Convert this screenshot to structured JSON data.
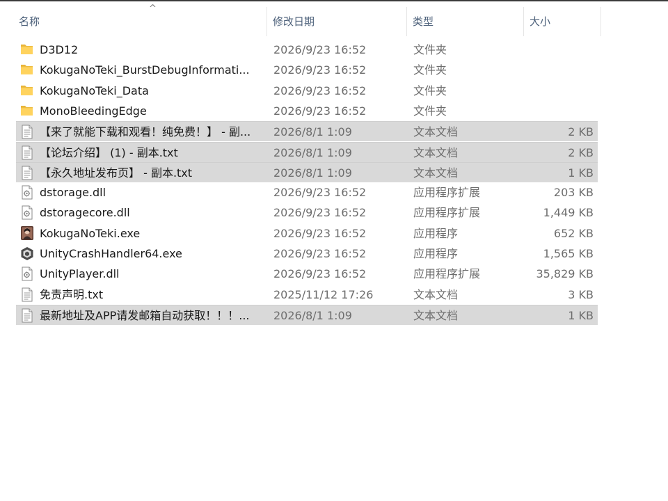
{
  "columns": {
    "name": "名称",
    "date": "修改日期",
    "type": "类型",
    "size": "大小"
  },
  "sort_indicator": "^",
  "files": [
    {
      "name": "D3D12",
      "date": "2026/9/23 16:52",
      "type": "文件夹",
      "size": "",
      "icon": "folder-icon",
      "selected": false
    },
    {
      "name": "KokugaNoTeki_BurstDebugInformati...",
      "date": "2026/9/23 16:52",
      "type": "文件夹",
      "size": "",
      "icon": "folder-icon",
      "selected": false
    },
    {
      "name": "KokugaNoTeki_Data",
      "date": "2026/9/23 16:52",
      "type": "文件夹",
      "size": "",
      "icon": "folder-icon",
      "selected": false
    },
    {
      "name": "MonoBleedingEdge",
      "date": "2026/9/23 16:52",
      "type": "文件夹",
      "size": "",
      "icon": "folder-icon",
      "selected": false
    },
    {
      "name": "【来了就能下载和观看！纯免费！】 - 副...",
      "date": "2026/8/1 1:09",
      "type": "文本文档",
      "size": "2 KB",
      "icon": "text-file-icon",
      "selected": true
    },
    {
      "name": "【论坛介绍】 (1) - 副本.txt",
      "date": "2026/8/1 1:09",
      "type": "文本文档",
      "size": "2 KB",
      "icon": "text-file-icon",
      "selected": true
    },
    {
      "name": "【永久地址发布页】 - 副本.txt",
      "date": "2026/8/1 1:09",
      "type": "文本文档",
      "size": "1 KB",
      "icon": "text-file-icon",
      "selected": true
    },
    {
      "name": "dstorage.dll",
      "date": "2026/9/23 16:52",
      "type": "应用程序扩展",
      "size": "203 KB",
      "icon": "dll-file-icon",
      "selected": false
    },
    {
      "name": "dstoragecore.dll",
      "date": "2026/9/23 16:52",
      "type": "应用程序扩展",
      "size": "1,449 KB",
      "icon": "dll-file-icon",
      "selected": false
    },
    {
      "name": "KokugaNoTeki.exe",
      "date": "2026/9/23 16:52",
      "type": "应用程序",
      "size": "652 KB",
      "icon": "game-exe-icon",
      "selected": false
    },
    {
      "name": "UnityCrashHandler64.exe",
      "date": "2026/9/23 16:52",
      "type": "应用程序",
      "size": "1,565 KB",
      "icon": "unity-icon",
      "selected": false
    },
    {
      "name": "UnityPlayer.dll",
      "date": "2026/9/23 16:52",
      "type": "应用程序扩展",
      "size": "35,829 KB",
      "icon": "dll-file-icon",
      "selected": false
    },
    {
      "name": "免责声明.txt",
      "date": "2025/11/12 17:26",
      "type": "文本文档",
      "size": "3 KB",
      "icon": "text-file-icon",
      "selected": false
    },
    {
      "name": "最新地址及APP请发邮箱自动获取！！！...",
      "date": "2026/8/1 1:09",
      "type": "文本文档",
      "size": "1 KB",
      "icon": "text-file-icon",
      "selected": true
    }
  ]
}
